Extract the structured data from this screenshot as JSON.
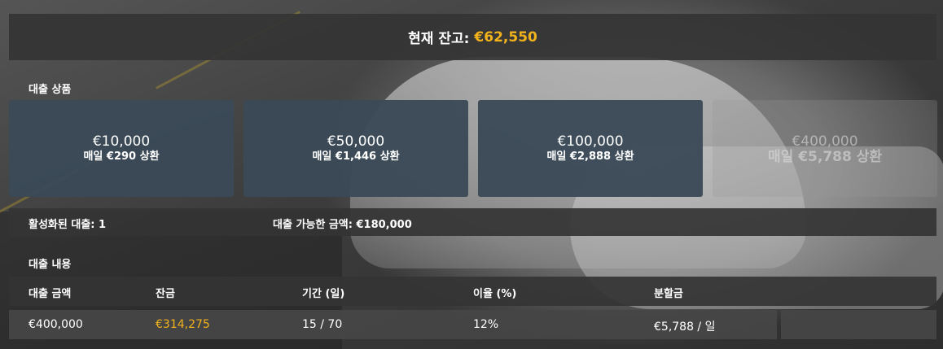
{
  "header": {
    "balance_label": "현재 잔고:",
    "balance_value": "€62,550"
  },
  "products": {
    "section_title": "대출 상품",
    "items": [
      {
        "amount": "€10,000",
        "repayment": "매일 €290 상환",
        "enabled": true
      },
      {
        "amount": "€50,000",
        "repayment": "매일 €1,446 상환",
        "enabled": true
      },
      {
        "amount": "€100,000",
        "repayment": "매일 €2,888 상환",
        "enabled": true
      },
      {
        "amount": "€400,000",
        "repayment": "매일 €5,788 상환",
        "enabled": false
      }
    ]
  },
  "status": {
    "active_loans": "활성화된 대출: 1",
    "available_amount": "대출 가능한 금액: €180,000"
  },
  "loans": {
    "section_title": "대출 내용",
    "columns": [
      "대출 금액",
      "잔금",
      "기간 (일)",
      "이율 (%)",
      "분할금"
    ],
    "rows": [
      {
        "amount": "€400,000",
        "balance": "€314,275",
        "term": "15 / 70",
        "rate": "12%",
        "installment": "€5,788 / 일"
      }
    ]
  },
  "colors": {
    "accent": "#f2b21c",
    "card": "#3a4a56",
    "panel": "#343434"
  }
}
